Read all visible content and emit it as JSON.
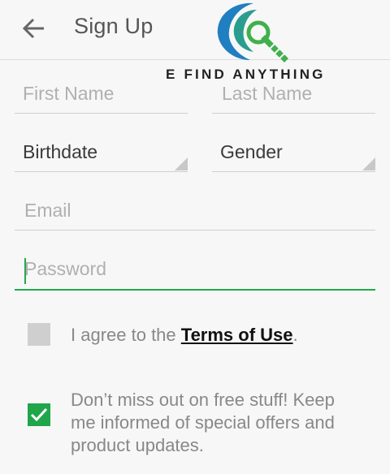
{
  "appbar": {
    "title": "Sign Up"
  },
  "logo": {
    "text": "E FIND ANYTHING"
  },
  "form": {
    "first_name": {
      "placeholder": "First Name"
    },
    "last_name": {
      "placeholder": "Last Name"
    },
    "birthdate": {
      "value": "Birthdate"
    },
    "gender": {
      "value": "Gender"
    },
    "email": {
      "placeholder": "Email"
    },
    "password": {
      "placeholder": "Password"
    }
  },
  "terms": {
    "checked": false,
    "prefix": "I agree to the ",
    "link": "Terms of Use",
    "suffix": "."
  },
  "newsletter": {
    "checked": true,
    "line1": "Don’t miss out on free stuff! Keep",
    "line2": "me informed of special offers and",
    "line3": "product updates."
  },
  "colors": {
    "accent": "#1fa64a",
    "logo_blue": "#1f7fc1",
    "logo_green": "#3fb04b"
  }
}
